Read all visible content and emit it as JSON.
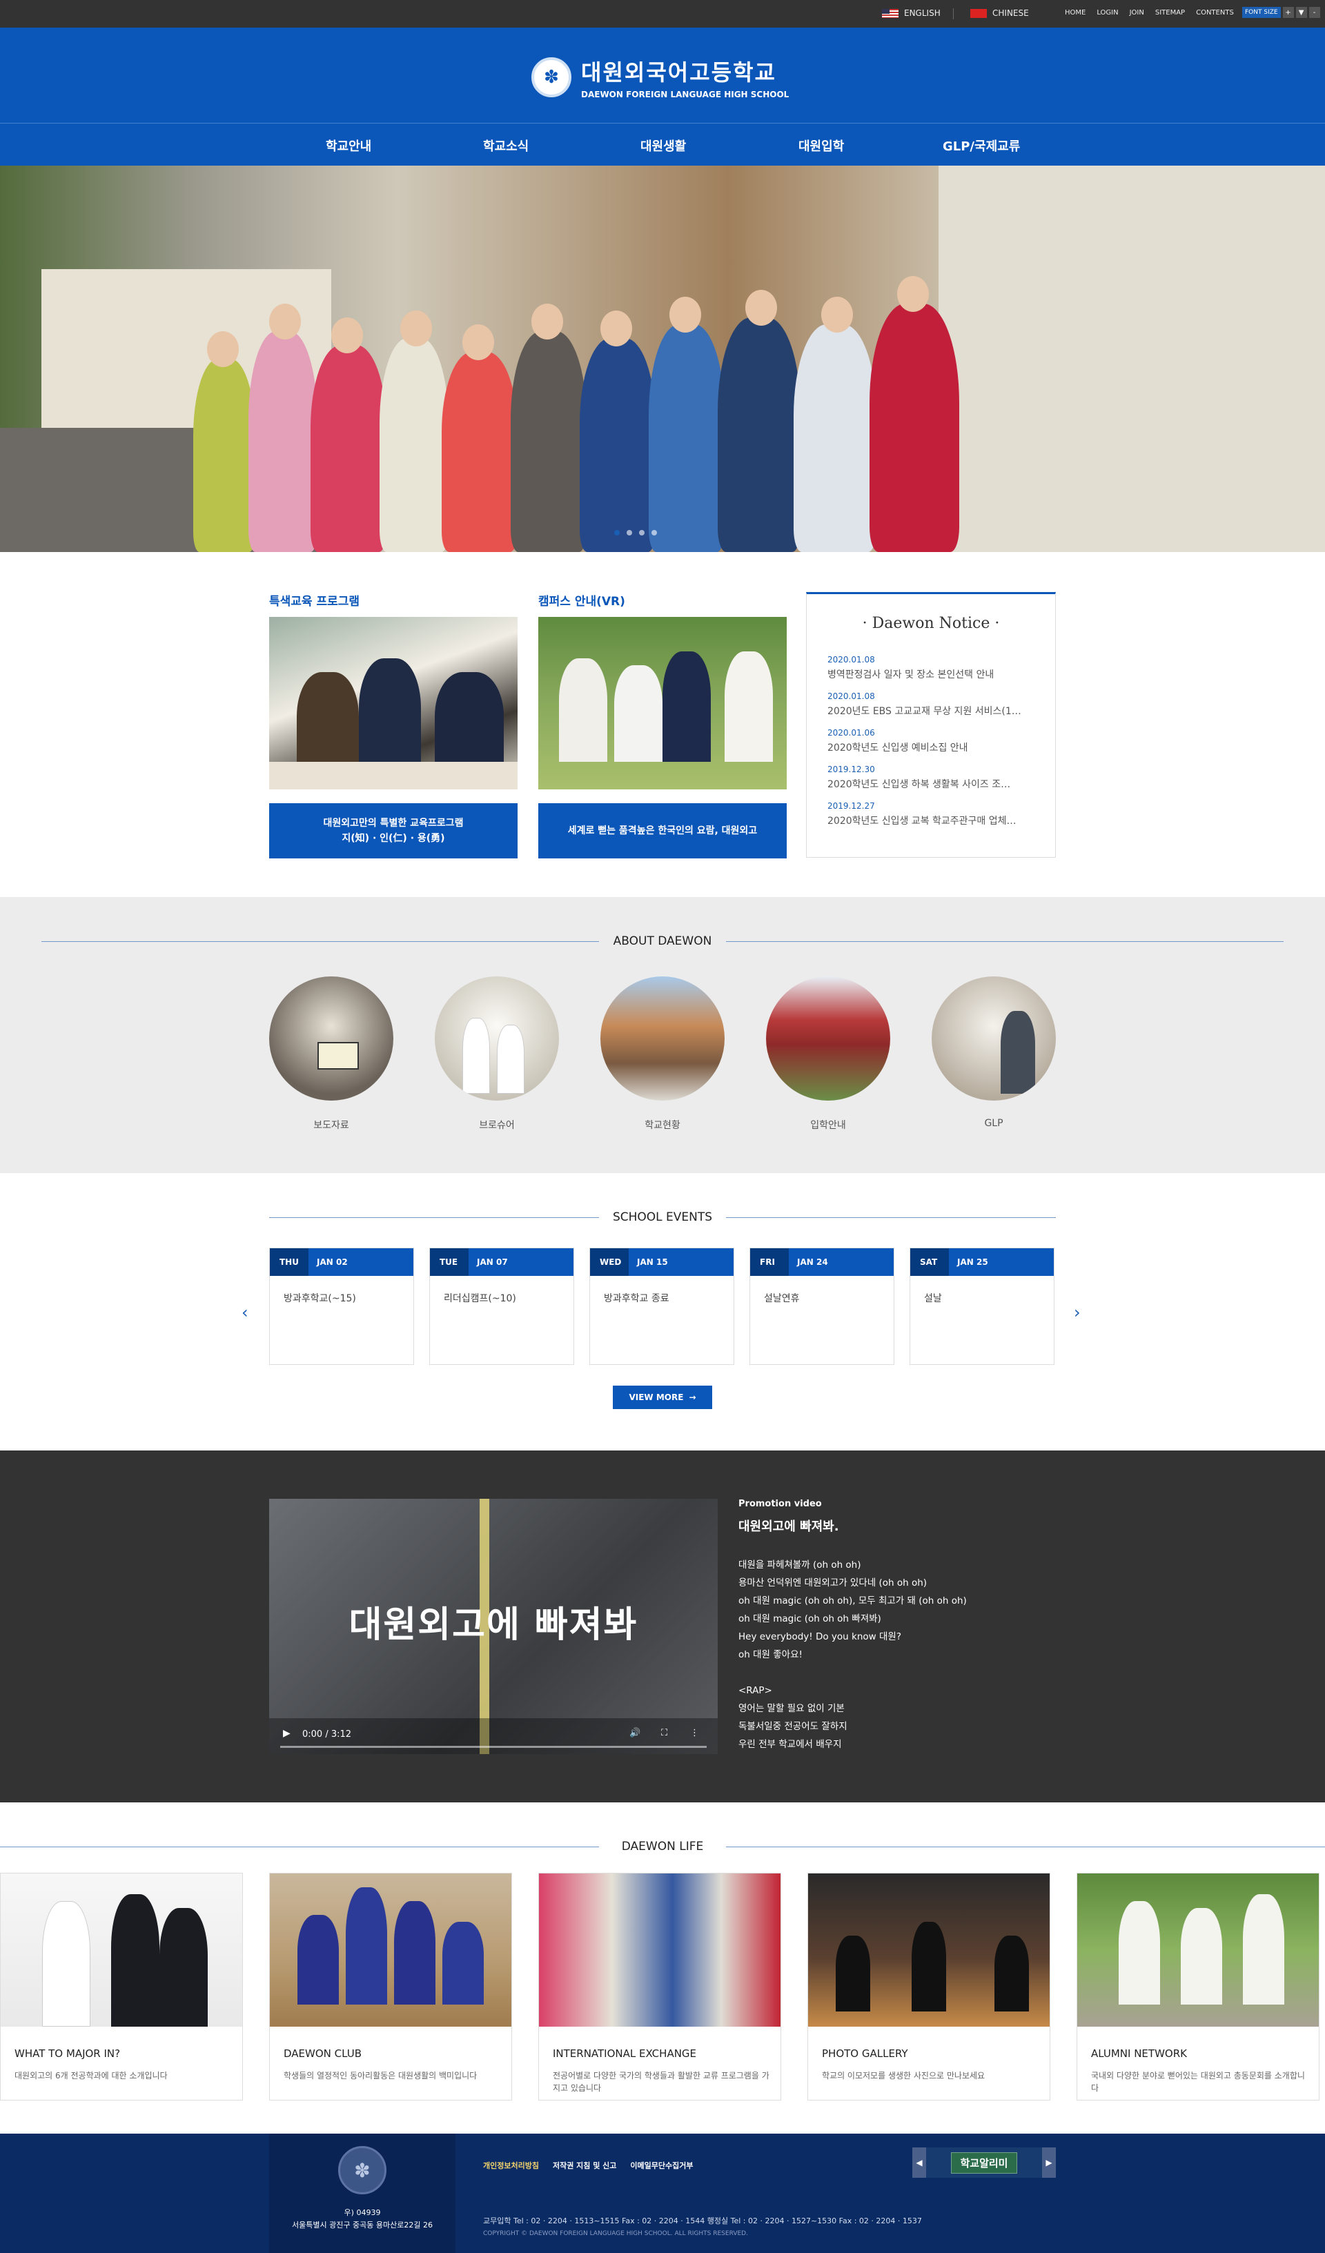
{
  "topbar": {
    "lang_english": "ENGLISH",
    "lang_chinese": "CHINESE",
    "links": [
      "HOME",
      "LOGIN",
      "JOIN",
      "SITEMAP",
      "CONTENTS"
    ],
    "font_size_label": "FONT SIZE",
    "font_buttons": [
      "+",
      "▼",
      "-"
    ]
  },
  "header": {
    "logo_kr": "대원외국어고등학교",
    "logo_en": "DAEWON FOREIGN LANGUAGE HIGH SCHOOL",
    "nav": [
      "학교안내",
      "학교소식",
      "대원생활",
      "대원입학",
      "GLP/국제교류"
    ]
  },
  "programs": {
    "special_title": "특색교육 프로그램",
    "special_button": "대원외고만의 특별한 교육프로그램\n지(知) · 인(仁) · 용(勇)",
    "campus_title": "캠퍼스 안내(VR)",
    "campus_button": "세계로 뻗는 품격높은 한국인의 요람, 대원외고"
  },
  "notice": {
    "title": "· Daewon Notice ·",
    "items": [
      {
        "date": "2020.01.08",
        "text": "병역판정검사 일자 및 장소 본인선택 안내"
      },
      {
        "date": "2020.01.08",
        "text": "2020년도 EBS 고교교재 무상 지원 서비스(1…"
      },
      {
        "date": "2020.01.06",
        "text": "2020학년도 신입생 예비소집 안내"
      },
      {
        "date": "2019.12.30",
        "text": "2020학년도 신입생 하복 생활복 사이즈 조…"
      },
      {
        "date": "2019.12.27",
        "text": "2020학년도 신입생 교복 학교주관구매 업체…"
      }
    ]
  },
  "about": {
    "heading": "ABOUT DAEWON",
    "items": [
      "보도자료",
      "브로슈어",
      "학교현황",
      "입학안내",
      "GLP"
    ]
  },
  "events": {
    "heading": "SCHOOL EVENTS",
    "items": [
      {
        "day": "THU",
        "date": "JAN 02",
        "title": "방과후학교(~15)"
      },
      {
        "day": "TUE",
        "date": "JAN 07",
        "title": "리더십캠프(~10)"
      },
      {
        "day": "WED",
        "date": "JAN 15",
        "title": "방과후학교 종료"
      },
      {
        "day": "FRI",
        "date": "JAN 24",
        "title": "설날연휴"
      },
      {
        "day": "SAT",
        "date": "JAN 25",
        "title": "설날"
      }
    ],
    "view_more": "VIEW MORE"
  },
  "promo": {
    "label": "Promotion video",
    "title": "대원외고에 빠져봐.",
    "video_text": "대원외고에 빠져봐",
    "video_time": "0:00 / 3:12",
    "lyrics": [
      "대원을 파헤쳐볼까 (oh oh oh)",
      "용마산 언덕위엔 대원외고가 있다네 (oh oh oh)",
      "oh 대원 magic (oh oh oh), 모두 최고가 돼 (oh oh oh)",
      "oh 대원 magic (oh oh oh 빠져봐)",
      "Hey everybody! Do you know 대원?",
      "oh 대원 좋아요!",
      "",
      "<RAP>",
      "영어는 말할 필요 없이 기본",
      "독불서일중 전공어도 잘하지",
      "우린 전부 학교에서 배우지"
    ]
  },
  "life": {
    "heading": "DAEWON LIFE",
    "items": [
      {
        "title": "WHAT TO MAJOR IN?",
        "desc": "대원외고의 6개 전공학과에 대한 소개입니다"
      },
      {
        "title": "DAEWON CLUB",
        "desc": "학생들의 열정적인 동아리활동은 대원생활의 백미입니다"
      },
      {
        "title": "INTERNATIONAL EXCHANGE",
        "desc": "전공어별로 다양한 국가의 학생들과 활발한 교류 프로그램을 가지고 있습니다"
      },
      {
        "title": "PHOTO GALLERY",
        "desc": "학교의 이모저모를 생생한 사진으로 만나보세요"
      },
      {
        "title": "ALUMNI NETWORK",
        "desc": "국내외 다양한 분야로 뻗어있는 대원외고 총동문회를 소개합니다"
      }
    ]
  },
  "footer": {
    "postal": "우) 04939",
    "address": "서울특별시 광진구 중곡동 용마산로22길 26",
    "links": [
      "개인정보처리방침",
      "저작권 지침 및 신고",
      "이메일무단수집거부"
    ],
    "info": "교무입학 Tel : 02 · 2204 · 1513~1515     Fax : 02 · 2204 · 1544     행정실 Tel : 02 · 2204 · 1527~1530     Fax : 02 · 2204 · 1537",
    "copyright": "COPYRIGHT © DAEWON FOREIGN LANGUAGE HIGH SCHOOL. ALL RIGHTS RESERVED.",
    "banner": "학교알리미"
  },
  "colors": {
    "primary": "#0a56b9",
    "dark": "#333333",
    "footer": "#0b2b64"
  }
}
